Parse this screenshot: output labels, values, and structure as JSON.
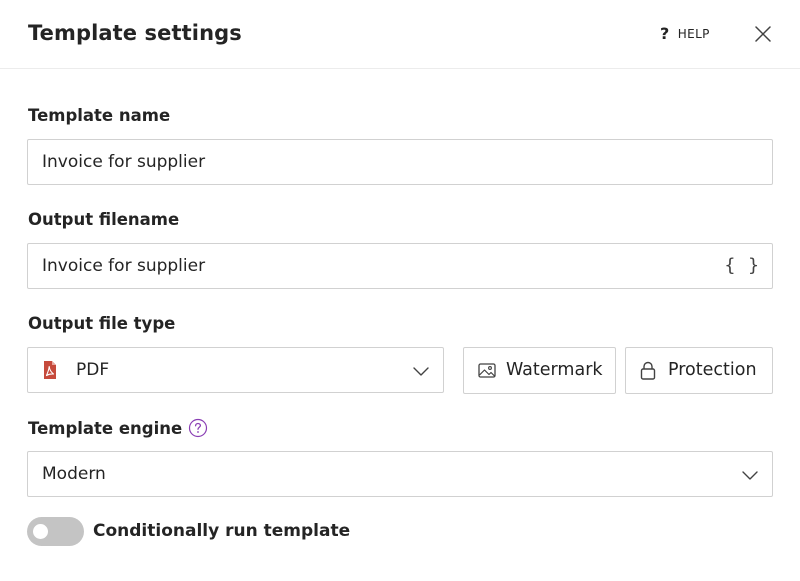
{
  "dialog": {
    "title": "Template settings",
    "help_label": "HELP",
    "help_glyph": "?"
  },
  "template_name": {
    "label": "Template name",
    "value": "Invoice for supplier"
  },
  "output_filename": {
    "label": "Output filename",
    "value": "Invoice for supplier",
    "insert_icon": "curly-braces-icon"
  },
  "output_file_type": {
    "label": "Output file type",
    "selected": "PDF",
    "selected_icon": "pdf-icon",
    "watermark_label": "Watermark",
    "protection_label": "Protection"
  },
  "template_engine": {
    "label": "Template engine",
    "selected": "Modern",
    "info_icon": "question-circle-icon"
  },
  "conditional": {
    "label": "Conditionally run template",
    "enabled": false
  },
  "colors": {
    "pdf_red": "#c64a3c",
    "info_purple": "#8a3fb4",
    "toggle_off": "#c4c4c4",
    "border": "#d1d1d1"
  }
}
